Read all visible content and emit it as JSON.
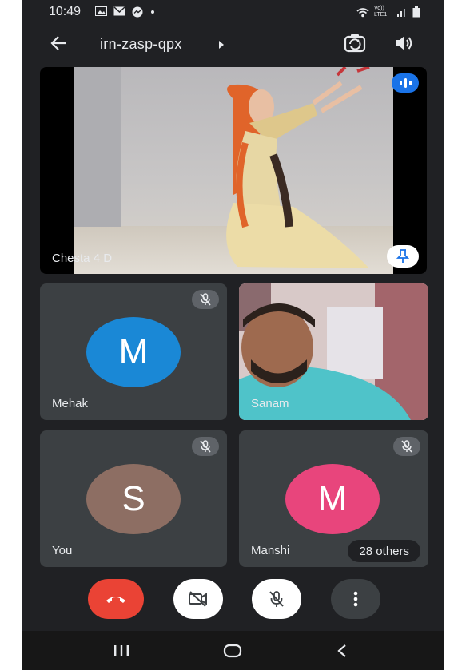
{
  "status_bar": {
    "time": "10:49",
    "network_text": "Vo)) LTE1"
  },
  "app_bar": {
    "meeting_code": "irn-zasp-qpx"
  },
  "participants": {
    "main": {
      "name": "Chesta 4 D"
    },
    "mehak": {
      "name": "Mehak",
      "initial": "M",
      "color": "#1a88d6"
    },
    "sanam": {
      "name": "Sanam"
    },
    "you": {
      "name": "You",
      "initial": "S",
      "color": "#8d6e63"
    },
    "manshi": {
      "name": "Manshi",
      "initial": "M",
      "color": "#e8457c"
    },
    "others_label": "28 others"
  },
  "colors": {
    "end_call": "#ea4335",
    "background": "#202124",
    "tile": "#3c4043",
    "accent": "#1a73e8"
  },
  "icons": {
    "back": "arrow-left-icon",
    "switch_camera": "switch-camera-icon",
    "speaker": "speaker-icon",
    "speaking": "audio-level-icon",
    "pin": "pin-icon",
    "mic_off": "mic-off-icon",
    "end_call": "end-call-icon",
    "camera_off": "camera-off-icon",
    "more": "more-vert-icon"
  }
}
